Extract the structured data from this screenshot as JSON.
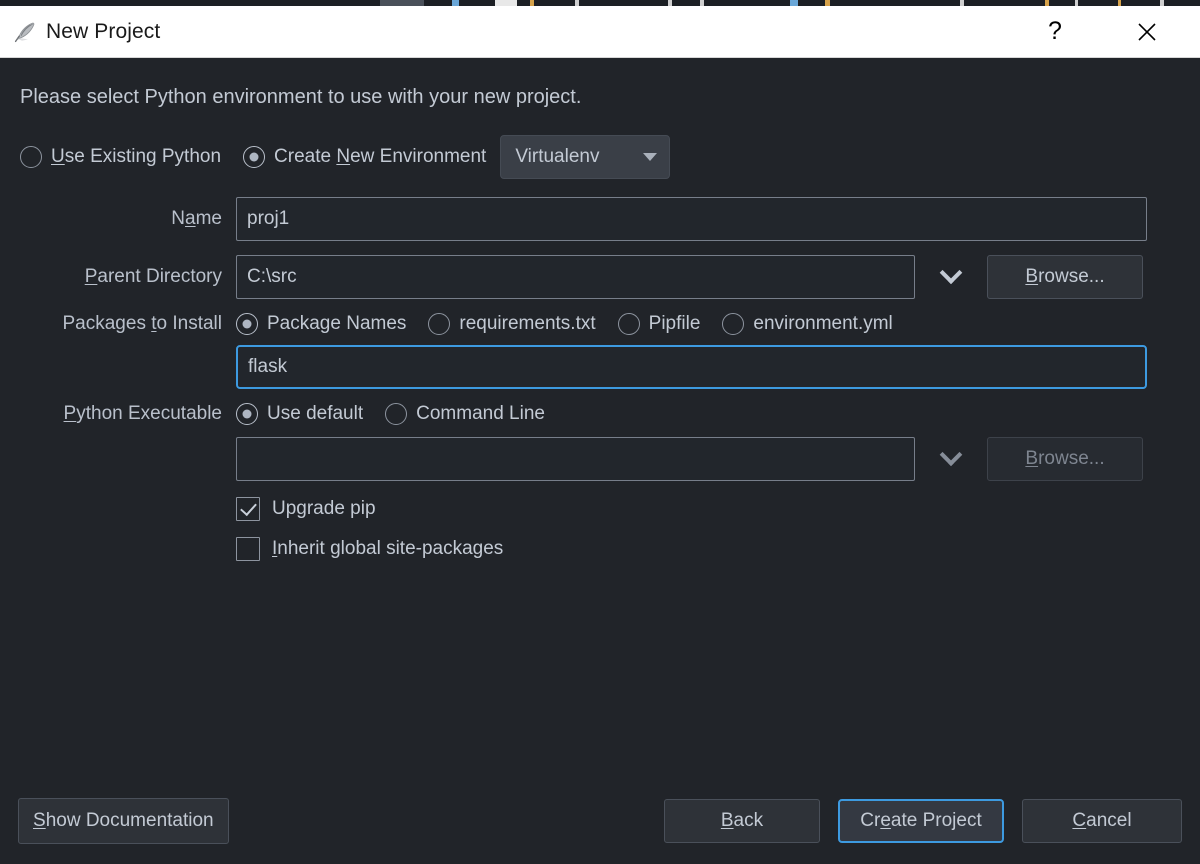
{
  "titlebar": {
    "icon": "feather-quill-icon",
    "title": "New Project",
    "help_label": "?",
    "close_label": "✕"
  },
  "body": {
    "prompt": "Please select Python environment to use with your new project."
  },
  "environment": {
    "use_existing": {
      "label_pre": "U",
      "label_post": "se Existing Python",
      "selected": false
    },
    "create_new": {
      "label_pre": "Create ",
      "label_key": "N",
      "label_post": "ew Environment",
      "selected": true
    },
    "type_dropdown": {
      "value": "Virtualenv",
      "icon": "chevron-down-icon"
    }
  },
  "name_row": {
    "label_pre": "N",
    "label_key": "a",
    "label_post": "me",
    "value": "proj1"
  },
  "parent_row": {
    "label_key": "P",
    "label_post": "arent Directory",
    "value": "C:\\src",
    "history_icon": "chevron-down-icon",
    "browse_key": "B",
    "browse_post": "rowse..."
  },
  "packages_row": {
    "label_pre": "Packages ",
    "label_key": "t",
    "label_post": "o Install",
    "options": [
      {
        "label": "Package Names",
        "selected": true
      },
      {
        "label": "requirements.txt",
        "selected": false
      },
      {
        "label": "Pipfile",
        "selected": false
      },
      {
        "label": "environment.yml",
        "selected": false
      }
    ],
    "input_value": "flask",
    "input_focused": true
  },
  "python_executable_row": {
    "label_key": "P",
    "label_post": "ython Executable",
    "options": [
      {
        "label": "Use default",
        "selected": true
      },
      {
        "label": "Command Line",
        "selected": false
      }
    ],
    "input_value": "",
    "history_icon": "chevron-down-icon",
    "browse_key": "B",
    "browse_post": "rowse...",
    "browse_disabled": true
  },
  "checkboxes": [
    {
      "label": "Upgrade pip",
      "checked": true
    },
    {
      "label_key": "I",
      "label_post": "nherit global site-packages",
      "checked": false
    }
  ],
  "footer": {
    "show_documentation": {
      "key": "S",
      "post": "how Documentation"
    },
    "back": {
      "key": "B",
      "post": "ack"
    },
    "create_project": {
      "pre": "Cr",
      "key": "e",
      "post": "ate Project",
      "focused": true
    },
    "cancel": {
      "key": "C",
      "post": "ancel"
    }
  },
  "colors": {
    "dialog_bg": "#212429",
    "titlebar_bg": "#ffffff",
    "accent_focus": "#3d9ae0",
    "text": "#c3cad4"
  }
}
